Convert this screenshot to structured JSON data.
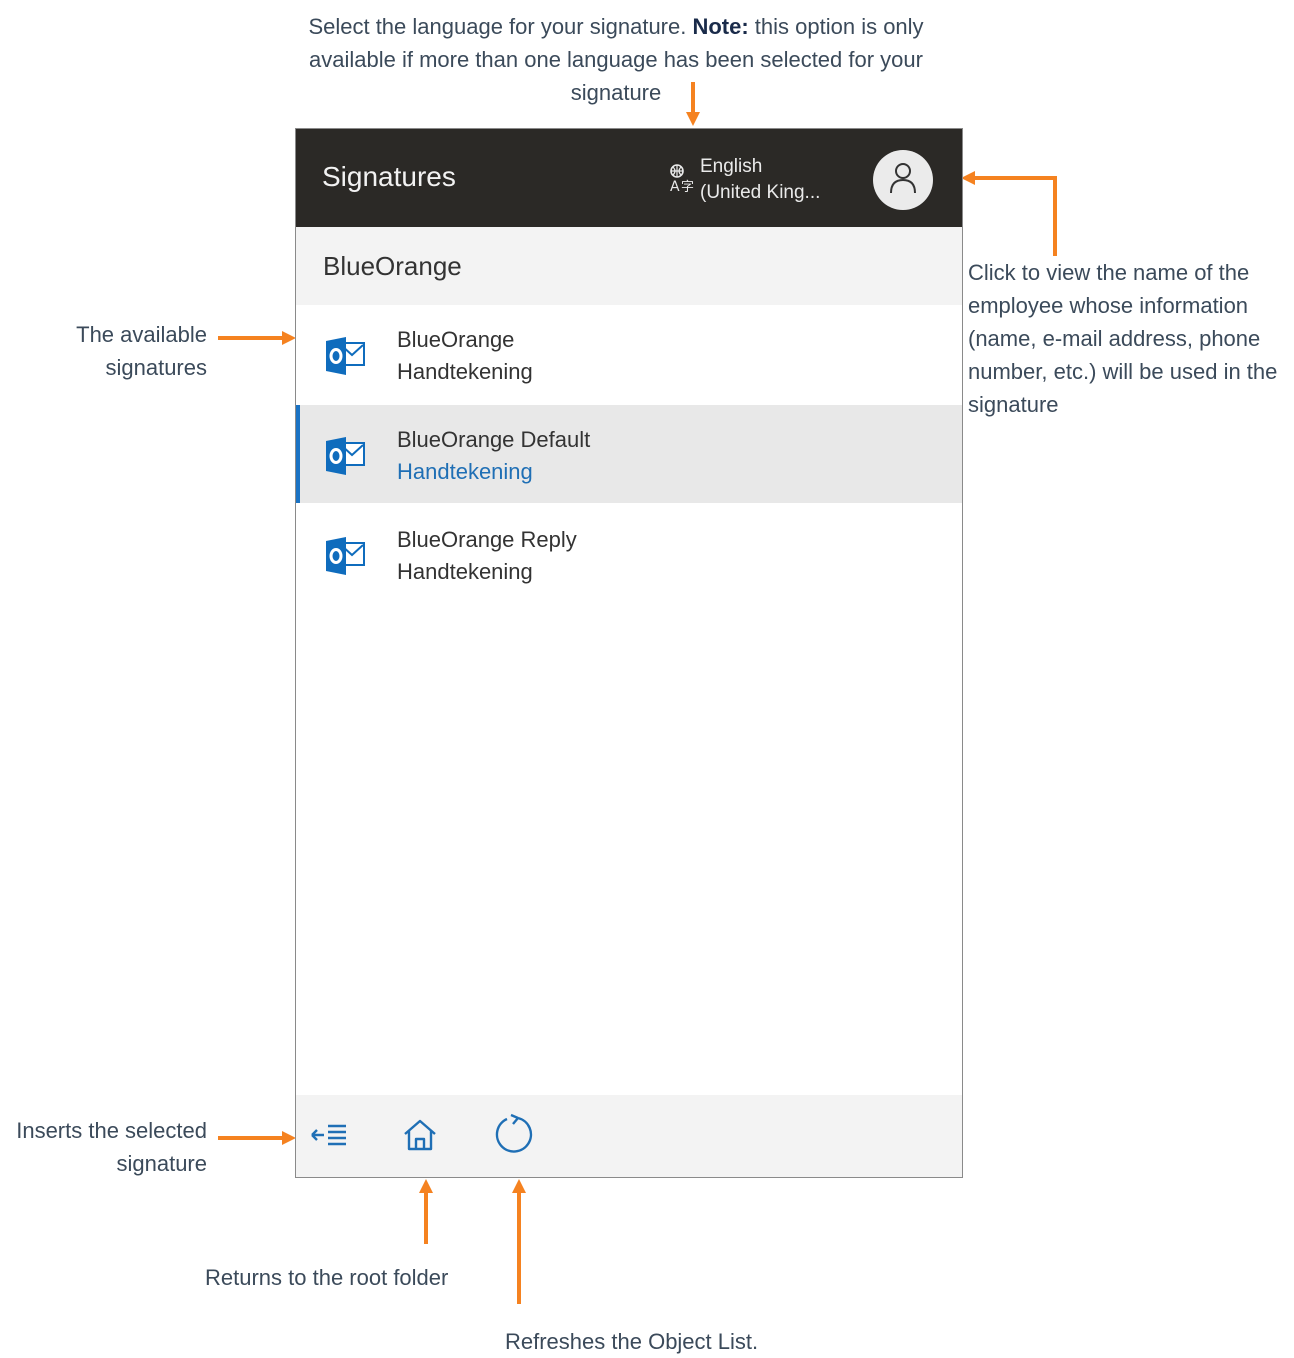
{
  "annotations": {
    "language_before_note": "Select the language for your signature. ",
    "language_note_label": "Note:",
    "language_after_note": " this option is only available if more than one language has been selected for your signature",
    "employee": "Click to view the name of the employee whose information (name, e-mail address, phone number, etc.) will be used in the signature",
    "available_signatures": "The available signatures",
    "insert": "Inserts the selected signature",
    "home": "Returns to the root folder",
    "refresh": "Refreshes the Object List."
  },
  "header": {
    "title": "Signatures",
    "language_line1": "English",
    "language_line2": "(United King..."
  },
  "folder": {
    "name": "BlueOrange"
  },
  "signatures": [
    {
      "name": "BlueOrange",
      "type": "Handtekening",
      "selected": false
    },
    {
      "name": "BlueOrange Default",
      "type": "Handtekening",
      "selected": true
    },
    {
      "name": "BlueOrange Reply",
      "type": "Handtekening",
      "selected": false
    }
  ],
  "colors": {
    "annotation_arrow": "#f58220",
    "header_bg": "#2b2926",
    "selected_accent": "#1a73c4",
    "outlook_blue": "#0f6cbd"
  },
  "icons": {
    "language": "translate-icon",
    "user": "user-icon",
    "signature": "outlook-icon",
    "insert": "insert-icon",
    "home": "home-icon",
    "refresh": "refresh-icon"
  }
}
